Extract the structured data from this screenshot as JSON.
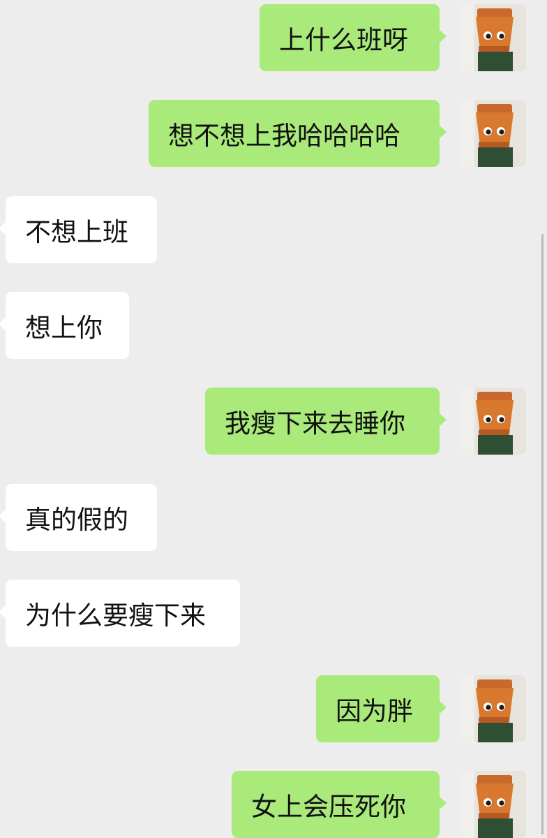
{
  "conversation": {
    "messages": [
      {
        "direction": "outgoing",
        "text": "上什么班呀",
        "avatar_icon": "toy-figure-avatar-icon"
      },
      {
        "direction": "outgoing",
        "text": "想不想上我哈哈哈哈",
        "avatar_icon": "toy-figure-avatar-icon"
      },
      {
        "direction": "incoming",
        "text": "不想上班"
      },
      {
        "direction": "incoming",
        "text": "想上你"
      },
      {
        "direction": "outgoing",
        "text": "我瘦下来去睡你",
        "avatar_icon": "toy-figure-avatar-icon"
      },
      {
        "direction": "incoming",
        "text": "真的假的"
      },
      {
        "direction": "incoming",
        "text": "为什么要瘦下来"
      },
      {
        "direction": "outgoing",
        "text": "因为胖",
        "avatar_icon": "toy-figure-avatar-icon"
      },
      {
        "direction": "outgoing",
        "text": "女上会压死你",
        "avatar_icon": "toy-figure-avatar-icon"
      }
    ]
  },
  "colors": {
    "background": "#ededed",
    "outgoing_bubble": "#a9ea7a",
    "incoming_bubble": "#ffffff"
  }
}
